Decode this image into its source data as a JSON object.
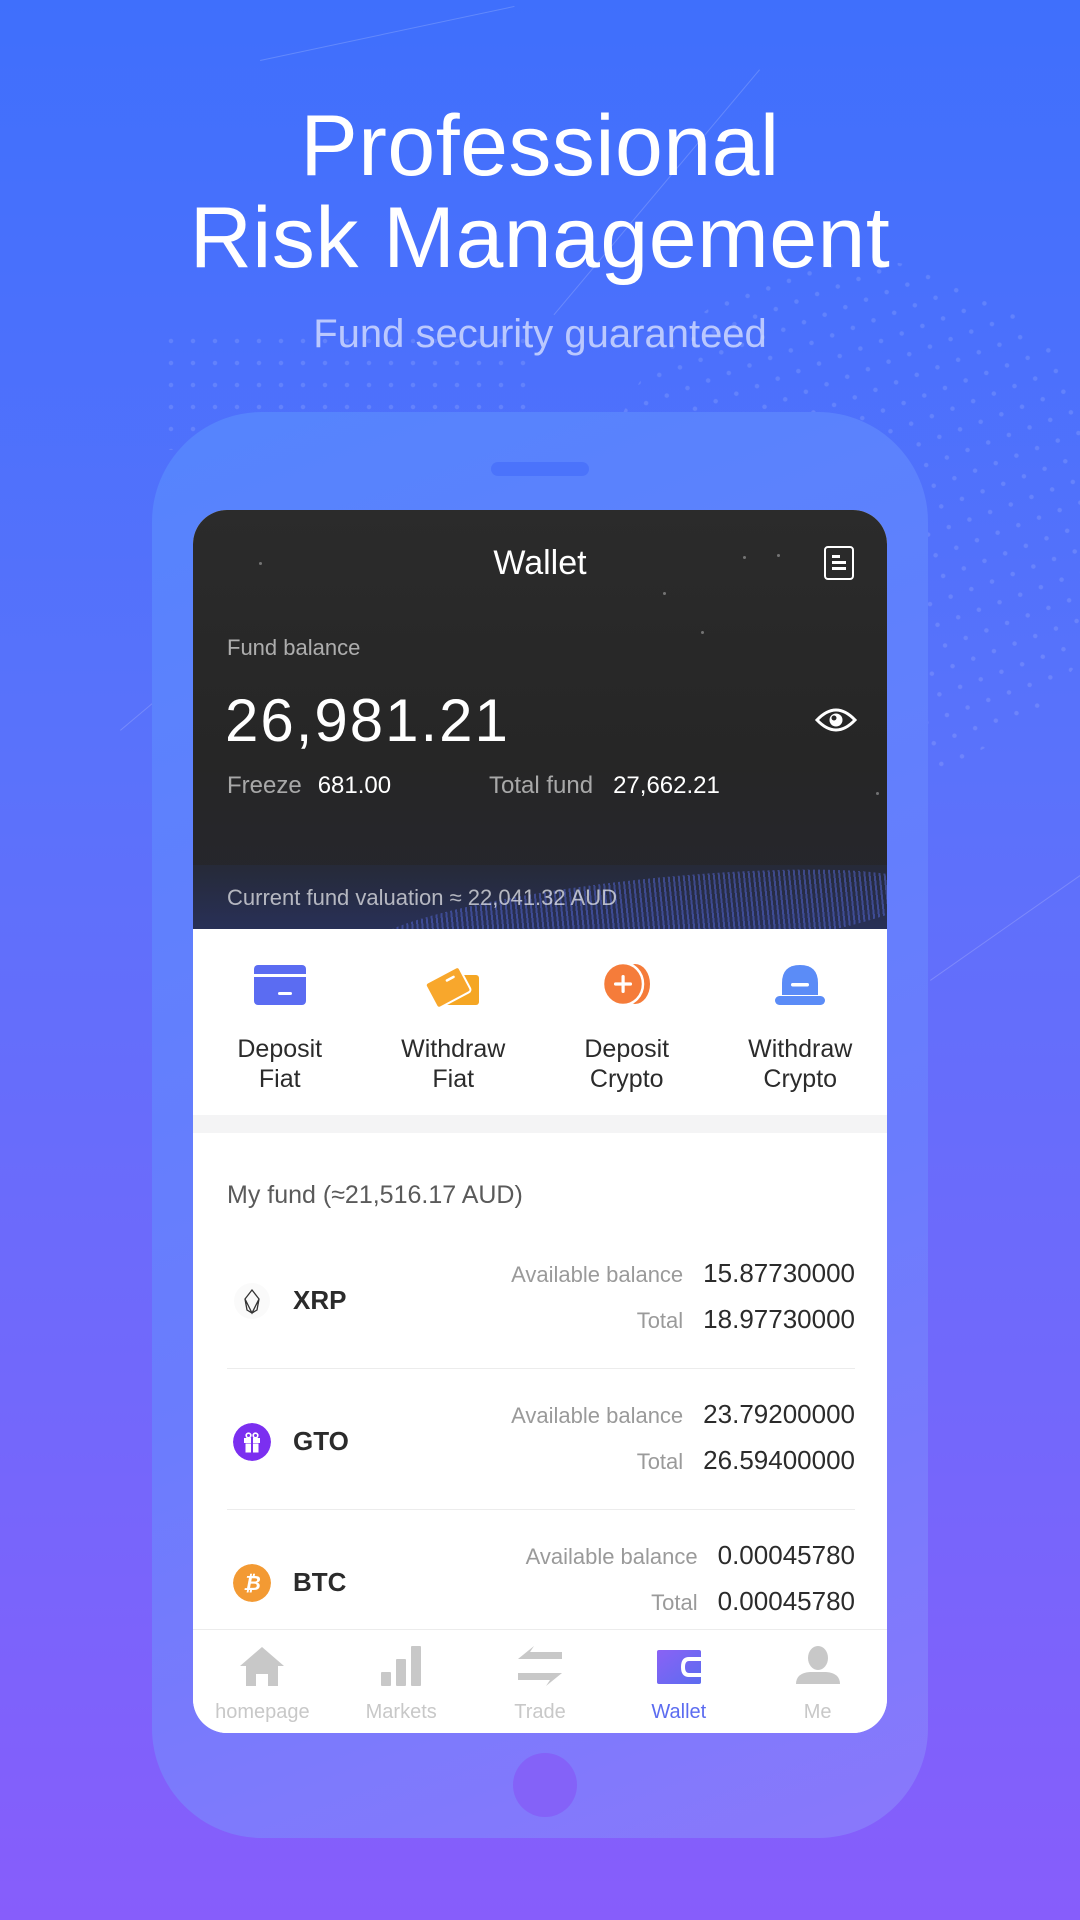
{
  "hero": {
    "title_line1": "Professional",
    "title_line2": "Risk Management",
    "subtitle": "Fund security guaranteed"
  },
  "wallet": {
    "title": "Wallet",
    "header_icon": "document-list-icon",
    "fund_balance_label": "Fund balance",
    "fund_balance": "26,981.21",
    "visibility_icon": "eye-icon",
    "freeze_label": "Freeze",
    "freeze_value": "681.00",
    "total_fund_label": "Total fund",
    "total_fund_value": "27,662.21",
    "valuation_text": "Current fund valuation ≈ 22,041.32 AUD"
  },
  "actions": [
    {
      "line1": "Deposit",
      "line2": "Fiat",
      "icon": "card-icon",
      "color": "#5b6cf2"
    },
    {
      "line1": "Withdraw",
      "line2": "Fiat",
      "icon": "cards-icon",
      "color": "#f5a623"
    },
    {
      "line1": "Deposit",
      "line2": "Crypto",
      "icon": "coin-plus-icon",
      "color": "#f57c3a"
    },
    {
      "line1": "Withdraw",
      "line2": "Crypto",
      "icon": "dome-minus-icon",
      "color": "#5b8cf7"
    }
  ],
  "my_fund": {
    "title": "My fund (≈21,516.17 AUD)",
    "available_label": "Available balance",
    "total_label": "Total",
    "coins": [
      {
        "symbol": "XRP",
        "available": "15.87730000",
        "total": "18.97730000",
        "icon": "eos-crystal-icon",
        "color": "#ffffff"
      },
      {
        "symbol": "GTO",
        "available": "23.79200000",
        "total": "26.59400000",
        "icon": "gift-icon",
        "color": "#7b2ff0"
      },
      {
        "symbol": "BTC",
        "available": "0.00045780",
        "total": "0.00045780",
        "icon": "bitcoin-icon",
        "color": "#f39a33"
      }
    ]
  },
  "tabbar": {
    "items": [
      {
        "label": "homepage",
        "icon": "home-icon",
        "active": false
      },
      {
        "label": "Markets",
        "icon": "bar-chart-icon",
        "active": false
      },
      {
        "label": "Trade",
        "icon": "swap-arrows-icon",
        "active": false
      },
      {
        "label": "Wallet",
        "icon": "wallet-icon",
        "active": true
      },
      {
        "label": "Me",
        "icon": "user-icon",
        "active": false
      }
    ],
    "active_color": "#5c6cf0",
    "inactive_color": "#c8c8c8"
  }
}
